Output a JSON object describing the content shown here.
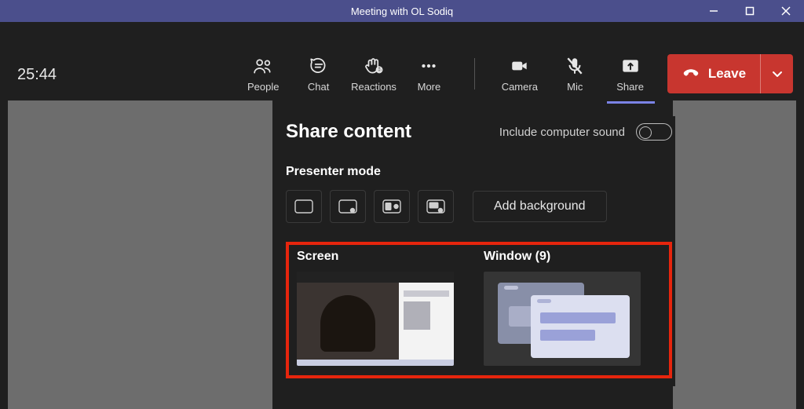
{
  "window_title": "Meeting with OL Sodiq",
  "timer": "25:44",
  "toolbar": {
    "people": "People",
    "chat": "Chat",
    "reactions": "Reactions",
    "more": "More",
    "camera": "Camera",
    "mic": "Mic",
    "share": "Share"
  },
  "leave": {
    "label": "Leave"
  },
  "share_panel": {
    "title": "Share content",
    "include_sound": "Include computer sound",
    "presenter_mode": "Presenter mode",
    "add_background": "Add background",
    "screen_label": "Screen",
    "window_label": "Window (9)"
  }
}
